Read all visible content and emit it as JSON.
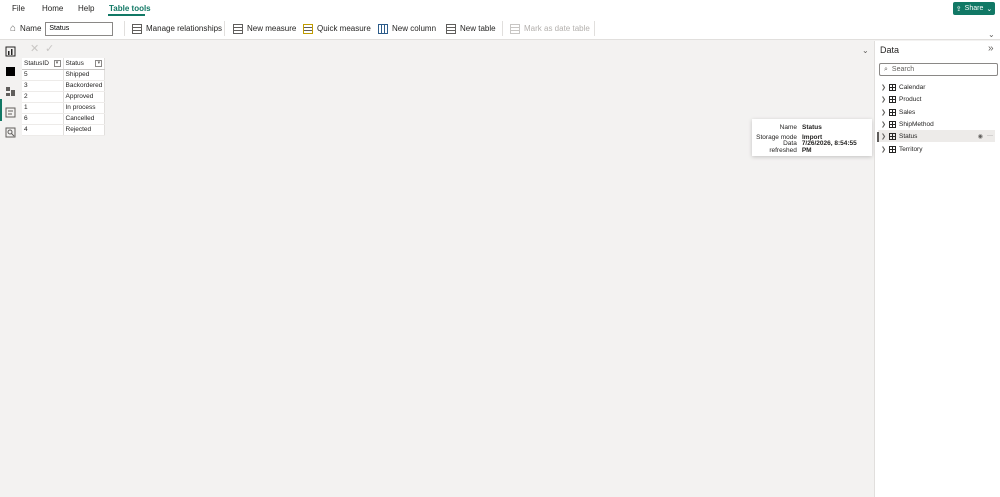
{
  "menu": {
    "items": [
      "File",
      "Home",
      "Help",
      "Table tools"
    ],
    "active": "Table tools",
    "share_label": "Share"
  },
  "ribbon": {
    "name_label": "Name",
    "name_value": "Status",
    "manage_relationships": "Manage relationships",
    "new_measure": "New measure",
    "quick_measure": "Quick measure",
    "new_column": "New column",
    "new_table": "New table",
    "mark_as_date_table": "Mark as date table"
  },
  "table": {
    "columns": [
      "StatusID",
      "Status"
    ],
    "rows": [
      [
        "5",
        "Shipped"
      ],
      [
        "3",
        "Backordered"
      ],
      [
        "2",
        "Approved"
      ],
      [
        "1",
        "In process"
      ],
      [
        "6",
        "Cancelled"
      ],
      [
        "4",
        "Rejected"
      ]
    ]
  },
  "tooltip": {
    "name_label": "Name",
    "name_value": "Status",
    "storage_label": "Storage mode",
    "storage_value": "Import",
    "refreshed_label": "Data refreshed",
    "refreshed_value": "7/26/2026, 8:54:55 PM"
  },
  "data_pane": {
    "title": "Data",
    "search_placeholder": "Search",
    "tables": [
      "Calendar",
      "Product",
      "Sales",
      "ShipMethod",
      "Status",
      "Territory"
    ]
  },
  "colors": {
    "accent": "#117865"
  }
}
